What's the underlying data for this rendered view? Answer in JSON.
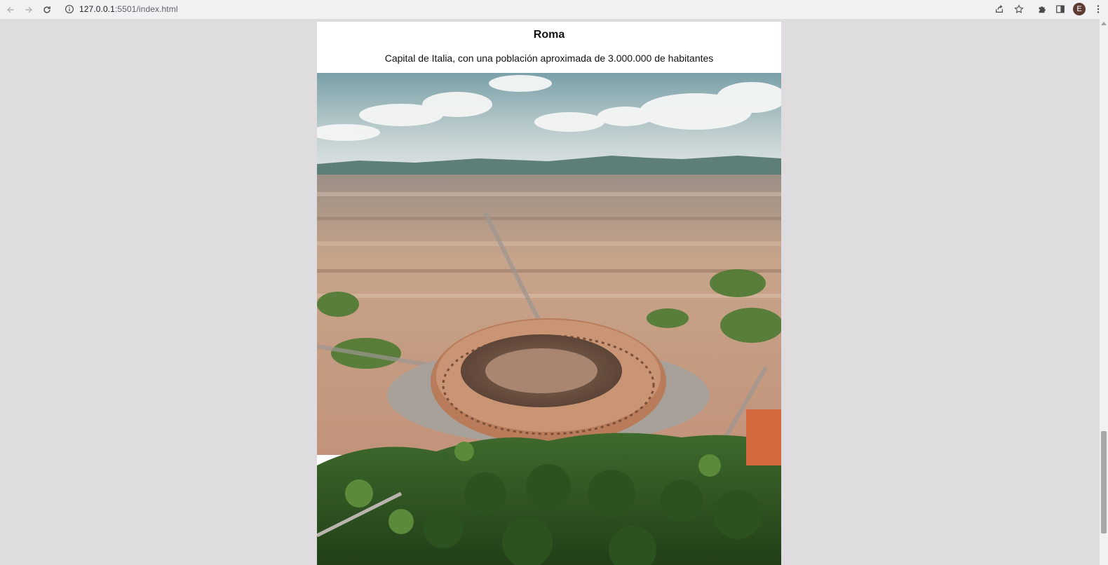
{
  "browser": {
    "url_host": "127.0.0.1",
    "url_rest": ":5501/index.html",
    "profile_initial": "E"
  },
  "card": {
    "title": "Roma",
    "description": "Capital de Italia, con una población aproximada de 3.000.000 de habitantes"
  },
  "scrollbar": {
    "position": 0.78
  },
  "colors": {
    "page_bg": "#dedcdf",
    "card_bg": "#ffffff",
    "avatar_bg": "#5d3a32"
  }
}
